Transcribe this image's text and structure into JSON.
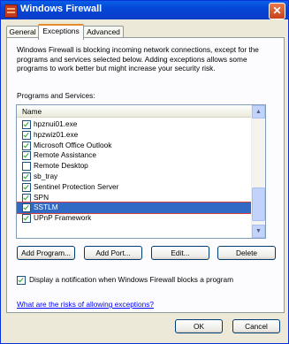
{
  "window": {
    "title": "Windows Firewall",
    "close_glyph": "✕"
  },
  "tabs": [
    "General",
    "Exceptions",
    "Advanced"
  ],
  "description": "Windows Firewall is blocking incoming network connections, except for the programs and services selected below. Adding exceptions allows some programs to work better but might increase your security risk.",
  "list_label": "Programs and Services:",
  "list_header": "Name",
  "programs": [
    {
      "label": "hpznui01.exe",
      "checked": true
    },
    {
      "label": "hpzwiz01.exe",
      "checked": true
    },
    {
      "label": "Microsoft Office Outlook",
      "checked": true
    },
    {
      "label": "Remote Assistance",
      "checked": true
    },
    {
      "label": "Remote Desktop",
      "checked": false
    },
    {
      "label": "sb_tray",
      "checked": true
    },
    {
      "label": "Sentinel Protection Server",
      "checked": true
    },
    {
      "label": "SPN",
      "checked": true
    },
    {
      "label": "SSTLM",
      "checked": true,
      "selected": true
    },
    {
      "label": "UPnP Framework",
      "checked": true
    }
  ],
  "buttons": {
    "add_program": "Add Program...",
    "add_port": "Add Port...",
    "edit": "Edit...",
    "delete": "Delete",
    "ok": "OK",
    "cancel": "Cancel"
  },
  "notification": "Display a notification when Windows Firewall blocks a program",
  "risk_link": "What are the risks of allowing exceptions?",
  "icons": {
    "title": "firewall-brick-icon",
    "scroll_up": "▲",
    "scroll_down": "▼"
  }
}
